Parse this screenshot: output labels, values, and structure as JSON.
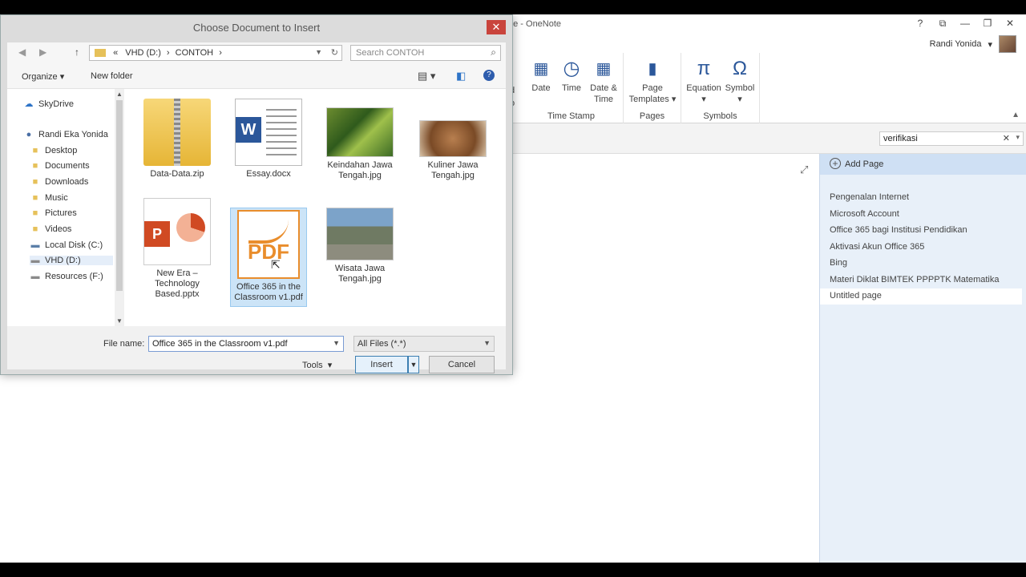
{
  "onenote": {
    "app_title": "ge - OneNote",
    "window_controls": [
      "?",
      "⧉",
      "—",
      "❐",
      "✕"
    ],
    "user_name": "Randi Yonida",
    "ribbon": {
      "partial_label_top": "d",
      "partial_label_bottom": "o",
      "groups": [
        {
          "label": "Time Stamp",
          "buttons": [
            {
              "label": "Date",
              "icon": "calendar-icon"
            },
            {
              "label": "Time",
              "icon": "clock-icon"
            },
            {
              "label": "Date &",
              "label2": "Time",
              "icon": "calendar-clock-icon"
            }
          ]
        },
        {
          "label": "Pages",
          "buttons": [
            {
              "label": "Page",
              "label2": "Templates",
              "caret": "▾",
              "icon": "page-template-icon"
            }
          ]
        },
        {
          "label": "Symbols",
          "buttons": [
            {
              "label": "Equation",
              "caret": "▾",
              "glyph": "π",
              "icon": "pi-icon"
            },
            {
              "label": "Symbol",
              "caret": "▾",
              "glyph": "Ω",
              "icon": "omega-icon"
            }
          ]
        }
      ]
    },
    "search": {
      "value": "verifikasi",
      "clear": "✕",
      "dropdown": "▾"
    },
    "add_page": "Add Page",
    "pages": [
      "Pengenalan Internet",
      "Microsoft Account",
      "Office 365 bagi Institusi Pendidikan",
      "Aktivasi Akun Office 365",
      "Bing",
      "Materi Diklat BIMTEK PPPPTK Matematika",
      "Untitled page"
    ]
  },
  "dialog": {
    "title": "Choose Document to Insert",
    "close": "✕",
    "address": {
      "prefix": "«",
      "path": [
        "VHD (D:)",
        "CONTOH"
      ],
      "separator": "›"
    },
    "search_placeholder": "Search CONTOH",
    "toolbar": {
      "organize": "Organize",
      "new_folder": "New folder",
      "help": "?"
    },
    "nav": [
      {
        "label": "SkyDrive",
        "icon": "cloud-icon",
        "color": "#2e74c7"
      },
      {
        "label": "Randi Eka Yonida",
        "icon": "homegroup-icon",
        "color": "#4a6fa5"
      },
      {
        "label": "Desktop",
        "icon": "folder-icon",
        "color": "#e6c15a"
      },
      {
        "label": "Documents",
        "icon": "folder-icon",
        "color": "#e6c15a"
      },
      {
        "label": "Downloads",
        "icon": "folder-icon",
        "color": "#e6c15a"
      },
      {
        "label": "Music",
        "icon": "folder-icon",
        "color": "#e6c15a"
      },
      {
        "label": "Pictures",
        "icon": "folder-icon",
        "color": "#e6c15a"
      },
      {
        "label": "Videos",
        "icon": "folder-icon",
        "color": "#e6c15a"
      },
      {
        "label": "Local Disk (C:)",
        "icon": "drive-icon",
        "color": "#5b7fa8"
      },
      {
        "label": "VHD (D:)",
        "icon": "drive-icon",
        "color": "#8a8a8a"
      },
      {
        "label": "Resources (F:)",
        "icon": "drive-icon",
        "color": "#8a8a8a"
      }
    ],
    "files": [
      {
        "name": "Data-Data.zip",
        "type": "zip"
      },
      {
        "name": "Essay.docx",
        "type": "docx"
      },
      {
        "name": "Keindahan Jawa Tengah.jpg",
        "type": "photo1"
      },
      {
        "name": "Kuliner Jawa Tengah.jpg",
        "type": "photo2"
      },
      {
        "name": "New Era – Technology Based.pptx",
        "type": "pptx"
      },
      {
        "name": "Office 365 in the Classroom v1.pdf",
        "type": "pdf",
        "selected": true
      },
      {
        "name": "Wisata Jawa Tengah.jpg",
        "type": "photo3"
      }
    ],
    "icon_labels": {
      "word": "W",
      "powerpoint": "P",
      "pdf": "PDF"
    },
    "file_name_label": "File name:",
    "file_name_value": "Office 365 in the Classroom v1.pdf",
    "filter": "All Files (*.*)",
    "tools": "Tools",
    "insert": "Insert",
    "cancel": "Cancel"
  }
}
